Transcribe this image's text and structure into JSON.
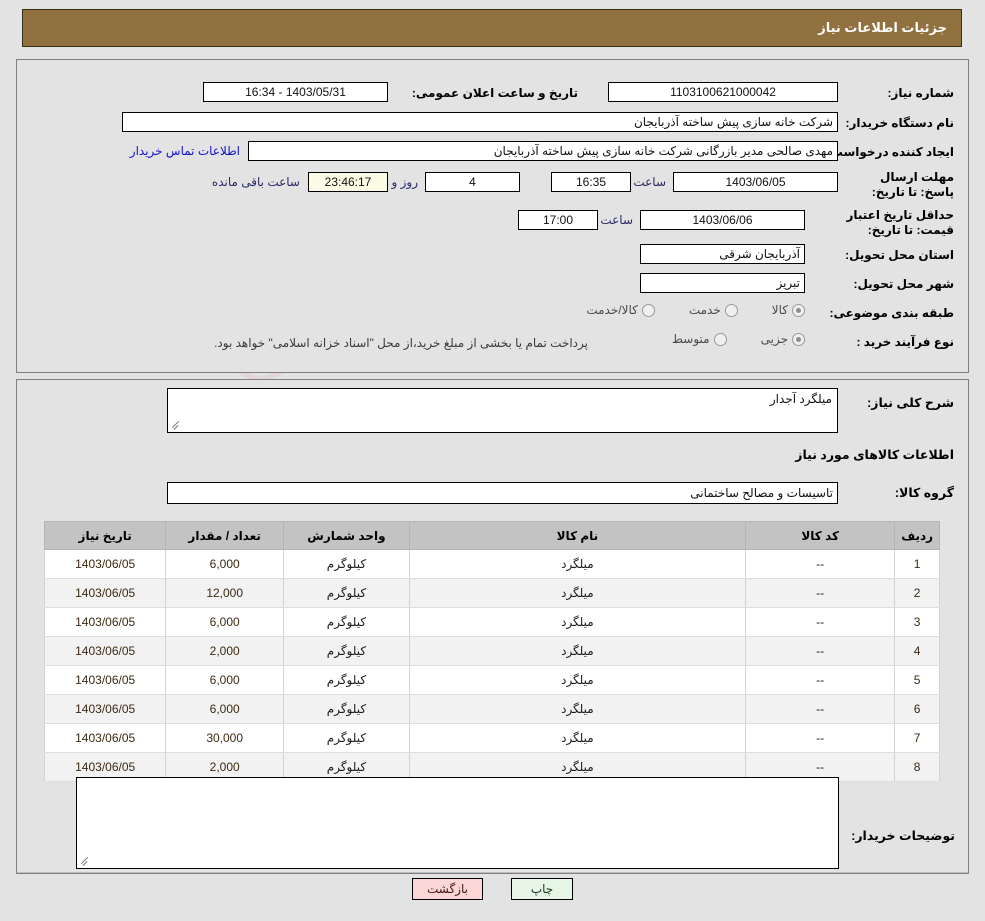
{
  "header": {
    "title": "جزئیات اطلاعات نیاز"
  },
  "top_form": {
    "need_number_label": "شماره نیاز:",
    "need_number_value": "1103100621000042",
    "public_announce_label": "تاریخ و ساعت اعلان عمومی:",
    "public_announce_value": "1403/05/31 - 16:34",
    "buyer_org_label": "نام دستگاه خریدار:",
    "buyer_org_value": "شرکت خانه سازی پیش ساخته آذربایجان",
    "requester_label": "ایجاد کننده درخواست:",
    "requester_value": "مهدی صالحی مدیر بازرگانی شرکت خانه سازی پیش ساخته آذربایجان",
    "contact_link": "اطلاعات تماس خریدار",
    "deadline_label": "مهلت ارسال پاسخ: تا تاریخ:",
    "deadline_date": "1403/06/05",
    "hour_label": "ساعت",
    "deadline_time": "16:35",
    "days_value": "4",
    "days_label": "روز و",
    "countdown_value": "23:46:17",
    "countdown_label": "ساعت باقی مانده",
    "price_valid_label": "حداقل تاریخ اعتبار قیمت: تا تاریخ:",
    "price_valid_date": "1403/06/06",
    "price_valid_time": "17:00",
    "province_label": "استان محل تحویل:",
    "province_value": "آذربایجان شرقی",
    "city_label": "شهر محل تحویل:",
    "city_value": "تبریز",
    "category_label": "طبقه بندی موضوعی:",
    "category_options": [
      "کالا",
      "خدمت",
      "کالا/خدمت"
    ],
    "category_selected": "کالا",
    "process_label": "نوع فرآیند خرید :",
    "process_options": [
      "جزیی",
      "متوسط"
    ],
    "process_selected": "جزیی",
    "process_note": "پرداخت تمام یا بخشی از مبلغ خرید،از محل \"اسناد خزانه اسلامی\" خواهد بود."
  },
  "main": {
    "need_desc_label": "شرح کلی نیاز:",
    "need_desc_value": "میلگرد آجدار",
    "items_section_title": "اطلاعات کالاهای مورد نیاز",
    "goods_group_label": "گروه کالا:",
    "goods_group_value": "تاسیسات و مصالح ساختمانی",
    "buyer_notes_label": "توضیحات خریدار:",
    "buyer_notes_value": ""
  },
  "table": {
    "columns": [
      "ردیف",
      "کد کالا",
      "نام کالا",
      "واحد شمارش",
      "تعداد / مقدار",
      "تاریخ نیاز"
    ],
    "rows": [
      {
        "row": "1",
        "code": "--",
        "name": "میلگرد",
        "unit": "کیلوگرم",
        "qty": "6,000",
        "date": "1403/06/05"
      },
      {
        "row": "2",
        "code": "--",
        "name": "میلگرد",
        "unit": "کیلوگرم",
        "qty": "12,000",
        "date": "1403/06/05"
      },
      {
        "row": "3",
        "code": "--",
        "name": "میلگرد",
        "unit": "کیلوگرم",
        "qty": "6,000",
        "date": "1403/06/05"
      },
      {
        "row": "4",
        "code": "--",
        "name": "میلگرد",
        "unit": "کیلوگرم",
        "qty": "2,000",
        "date": "1403/06/05"
      },
      {
        "row": "5",
        "code": "--",
        "name": "میلگرد",
        "unit": "کیلوگرم",
        "qty": "6,000",
        "date": "1403/06/05"
      },
      {
        "row": "6",
        "code": "--",
        "name": "میلگرد",
        "unit": "کیلوگرم",
        "qty": "6,000",
        "date": "1403/06/05"
      },
      {
        "row": "7",
        "code": "--",
        "name": "میلگرد",
        "unit": "کیلوگرم",
        "qty": "30,000",
        "date": "1403/06/05"
      },
      {
        "row": "8",
        "code": "--",
        "name": "میلگرد",
        "unit": "کیلوگرم",
        "qty": "2,000",
        "date": "1403/06/05"
      }
    ]
  },
  "footer": {
    "print_label": "چاپ",
    "back_label": "بازگشت"
  },
  "watermark": {
    "text": "AriaTender.net"
  },
  "colors": {
    "header_bg": "#91713f",
    "page_bg": "#e3e3e3",
    "link": "#1414cc",
    "table_header_bg": "#c3c3c3",
    "print_btn_bg": "#e8f6e8",
    "back_btn_bg": "#fbd6d6",
    "countdown_bg": "#fbfbe6"
  }
}
